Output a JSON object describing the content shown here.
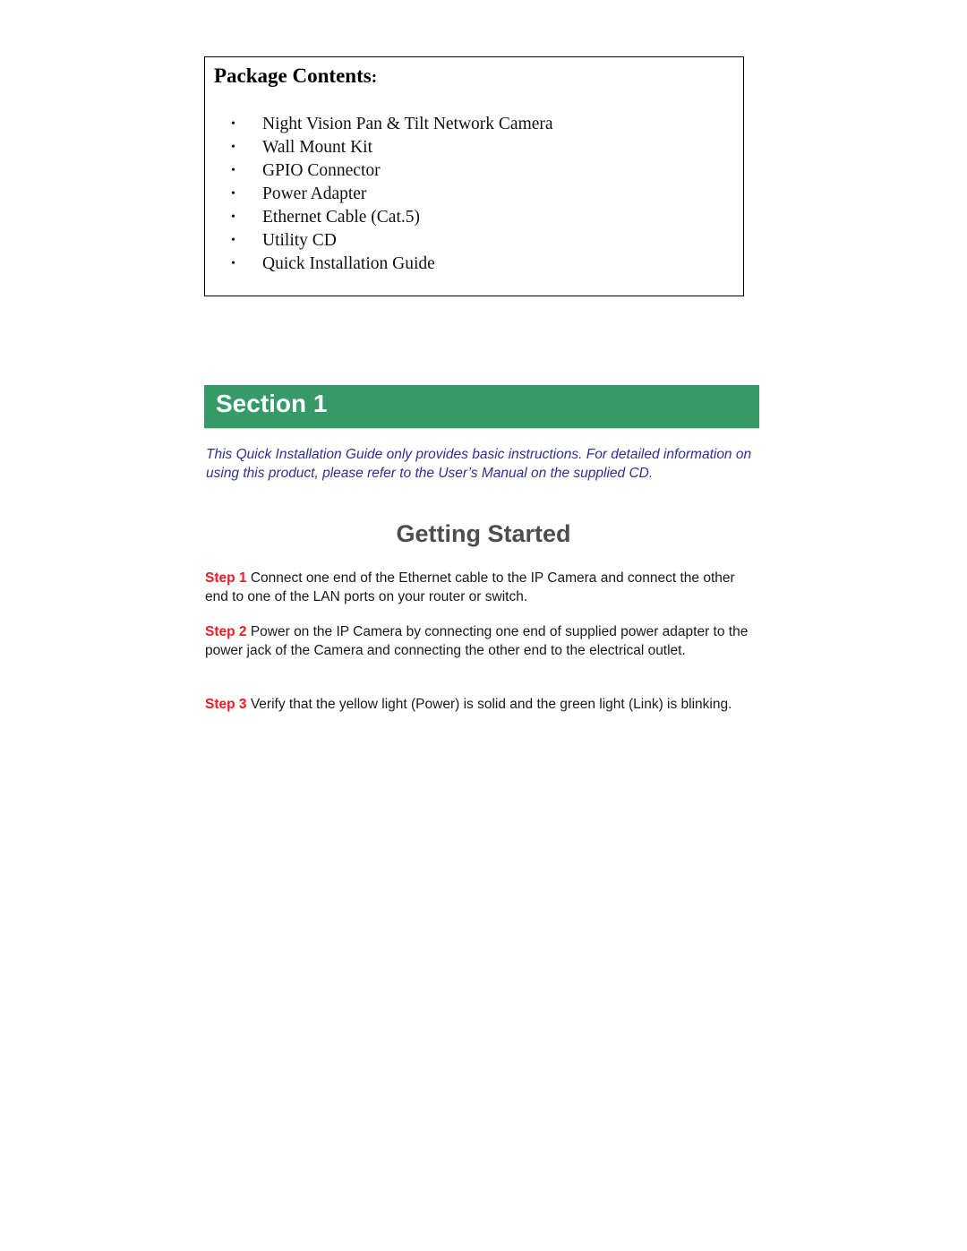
{
  "package_contents": {
    "title": "Package Contents",
    "title_suffix": ":",
    "bullet": "•",
    "items": [
      "Night Vision Pan & Tilt Network Camera",
      "Wall Mount Kit",
      "GPIO Connector",
      "Power Adapter",
      "Ethernet Cable (Cat.5)",
      "Utility CD",
      "Quick Installation Guide"
    ]
  },
  "section": {
    "label": "Section 1",
    "color": "#359A68"
  },
  "intro": "This Quick Installation Guide only provides basic instructions.  For detailed information on using this product, please refer to the User’s Manual on the supplied CD.",
  "getting_started": {
    "title": "Getting Started",
    "steps": [
      {
        "label": "Step 1",
        "text": " Connect one end of the Ethernet cable to the IP Camera and connect the other end to one of the LAN ports on your router or switch."
      },
      {
        "label": "Step 2",
        "text": " Power on the IP Camera by connecting one end of supplied power adapter to the power jack of the Camera and connecting the other end to the electrical outlet."
      },
      {
        "label": "Step 3",
        "text": " Verify that the yellow light (Power) is solid and the green light (Link) is blinking."
      }
    ]
  },
  "colors": {
    "step_label": "#ee1c25",
    "intro_text": "#2e3192",
    "heading_gray": "#4d4d4d"
  }
}
